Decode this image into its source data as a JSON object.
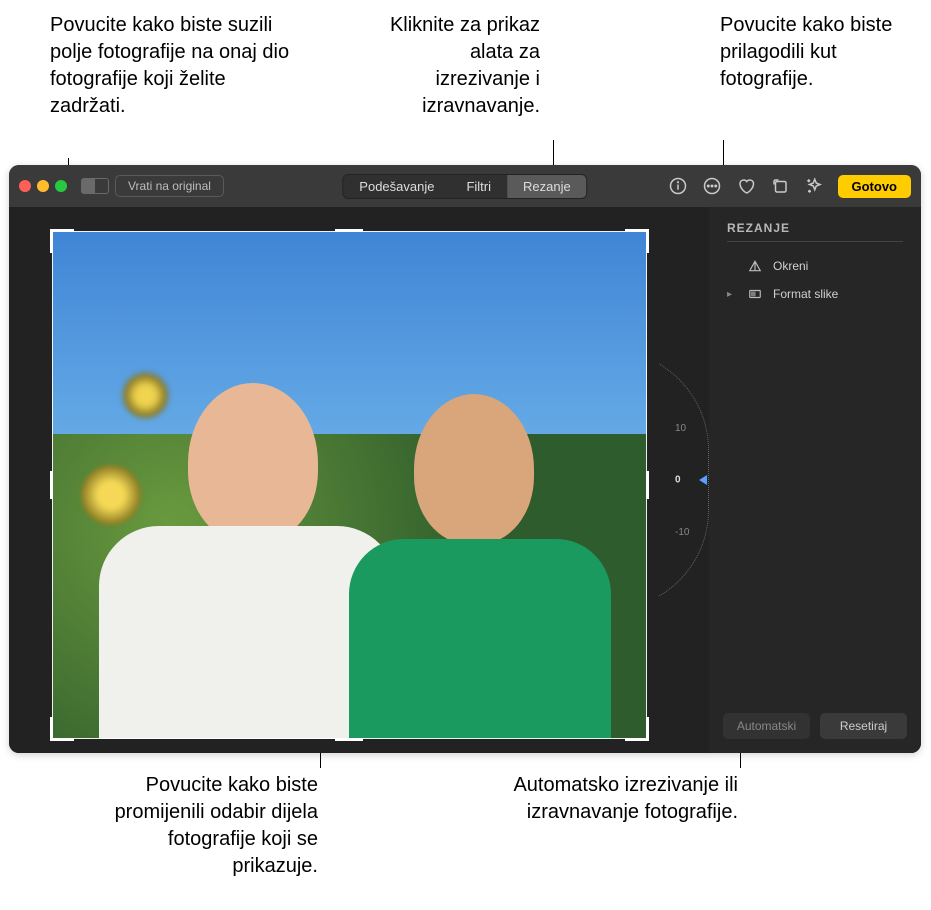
{
  "callouts": {
    "top_left": "Povucite kako biste suzili polje fotografije na onaj dio fotografije koji želite zadržati.",
    "top_center": "Kliknite za prikaz alata za izrezivanje i izravnavanje.",
    "top_right": "Povucite kako biste prilagodili kut fotografije.",
    "bottom_left": "Povucite kako biste promijenili odabir dijela fotografije koji se prikazuje.",
    "bottom_right": "Automatsko izrezivanje ili izravnavanje fotografije."
  },
  "toolbar": {
    "revert": "Vrati na original",
    "tabs": {
      "adjust": "Podešavanje",
      "filters": "Filtri",
      "crop": "Rezanje"
    },
    "done": "Gotovo"
  },
  "panel": {
    "title": "REZANJE",
    "flip": "Okreni",
    "aspect": "Format slike"
  },
  "dial": {
    "plus10": "10",
    "zero": "0",
    "minus10": "-10"
  },
  "actions": {
    "auto": "Automatski",
    "reset": "Resetiraj"
  }
}
